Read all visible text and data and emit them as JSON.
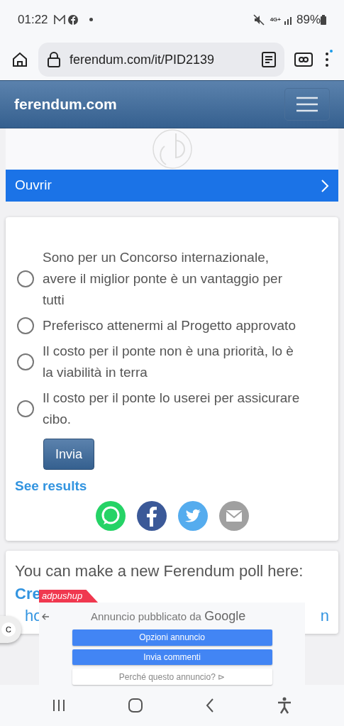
{
  "status_bar": {
    "time": "01:22",
    "battery": "89%",
    "network": "4G+"
  },
  "browser": {
    "url": "ferendum.com/it/PID2139"
  },
  "header": {
    "logo": "ferendum.com"
  },
  "open_bar": {
    "label": "Ouvrir"
  },
  "poll": {
    "options": [
      {
        "label": "Sono per un Concorso internazionale, avere il miglior ponte è un vantaggio per tutti",
        "selected": false
      },
      {
        "label": "Preferisco attenermi al Progetto approvato",
        "selected": false
      },
      {
        "label": "Il costo per il ponte non è una priorità, lo è la viabilità in terra",
        "selected": false
      },
      {
        "label": "Il costo per il ponte lo userei per assicurare cibo.",
        "selected": false
      }
    ],
    "submit": "Invia",
    "results_link": "See results"
  },
  "promo": {
    "text": "You can make a new Ferendum poll here:",
    "link": "Cre",
    "line2_start": "ho",
    "line2_end": "n"
  },
  "ad_overlay": {
    "tag": "adpushup",
    "title_prefix": "Annuncio pubblicato da",
    "title_brand": "Google",
    "buttons": [
      {
        "label": "Opzioni annuncio",
        "kind": "primary"
      },
      {
        "label": "Invia commenti",
        "kind": "primary"
      },
      {
        "label": "Perché questo annuncio? ⊳",
        "kind": "secondary"
      }
    ],
    "bubble": "C"
  }
}
